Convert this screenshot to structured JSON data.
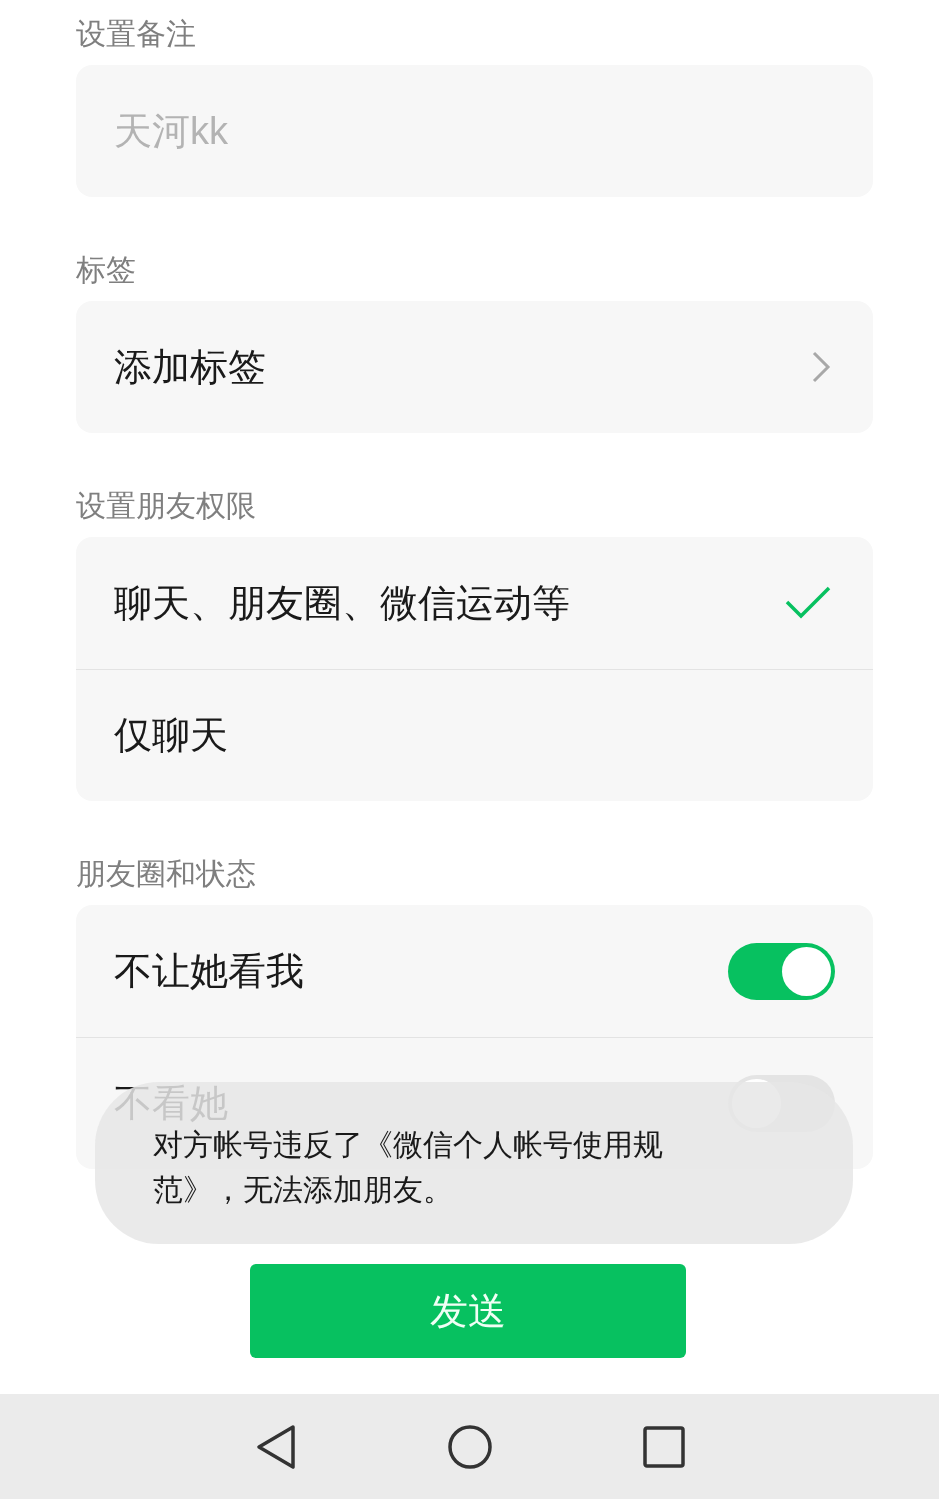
{
  "remark": {
    "label": "设置备注",
    "placeholder": "天河kk"
  },
  "tags": {
    "label": "标签",
    "item": "添加标签"
  },
  "permissions": {
    "label": "设置朋友权限",
    "options": [
      {
        "label": "聊天、朋友圈、微信运动等",
        "selected": true
      },
      {
        "label": "仅聊天",
        "selected": false
      }
    ]
  },
  "moments": {
    "label": "朋友圈和状态",
    "items": [
      {
        "label": "不让她看我",
        "on": true
      },
      {
        "label": "不看她",
        "on": false
      }
    ]
  },
  "toast": "对方帐号违反了《微信个人帐号使用规范》，无法添加朋友。",
  "send_button": "发送"
}
